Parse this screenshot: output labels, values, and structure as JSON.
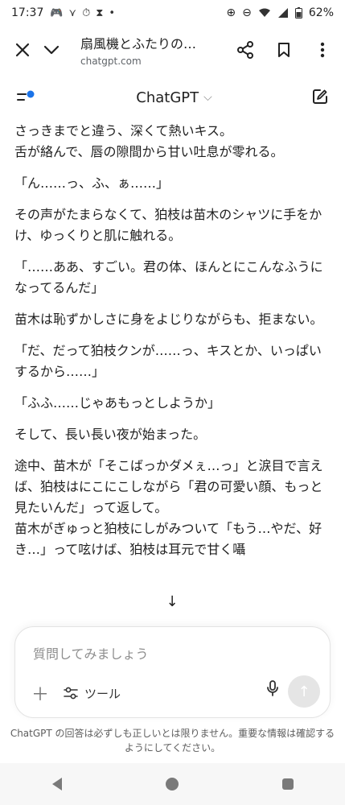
{
  "status": {
    "time": "17:37",
    "icons": [
      "🎮",
      "⋎",
      "⏱",
      "⧗",
      "•"
    ],
    "right_icons": [
      "⊕",
      "⊖"
    ],
    "battery": "62%"
  },
  "browser": {
    "title": "扇風機とふたりの…",
    "url": "chatgpt.com"
  },
  "app": {
    "title": "ChatGPT",
    "accent": "#1a73e8"
  },
  "content": {
    "paragraphs": [
      "さっきまでと違う、深くて熱いキス。",
      "舌が絡んで、唇の隙間から甘い吐息が零れる。",
      "「ん……っ、ふ、ぁ……」",
      "その声がたまらなくて、狛枝は苗木のシャツに手をかけ、ゆっくりと肌に触れる。",
      "「……ああ、すごい。君の体、ほんとにこんなふうになってるんだ」",
      "苗木は恥ずかしさに身をよじりながらも、拒まない。",
      "「だ、だって狛枝クンが……っ、キスとか、いっぱいするから……」",
      "「ふふ……じゃあもっとしようか」",
      "そして、長い長い夜が始まった。",
      "途中、苗木が「そこばっかダメぇ…っ」と涙目で言えば、狛枝はにこにこしながら「君の可愛い顔、もっと見たいんだ」って返して。",
      "苗木がぎゅっと狛枝にしがみついて「もう…やだ、好き…」って呟けば、狛枝は耳元で甘く囁"
    ]
  },
  "composer": {
    "placeholder": "質問してみましょう",
    "tools_label": "ツール"
  },
  "disclaimer": "ChatGPT の回答は必ずしも正しいとは限りません。重要な情報は確認するようにしてください。"
}
